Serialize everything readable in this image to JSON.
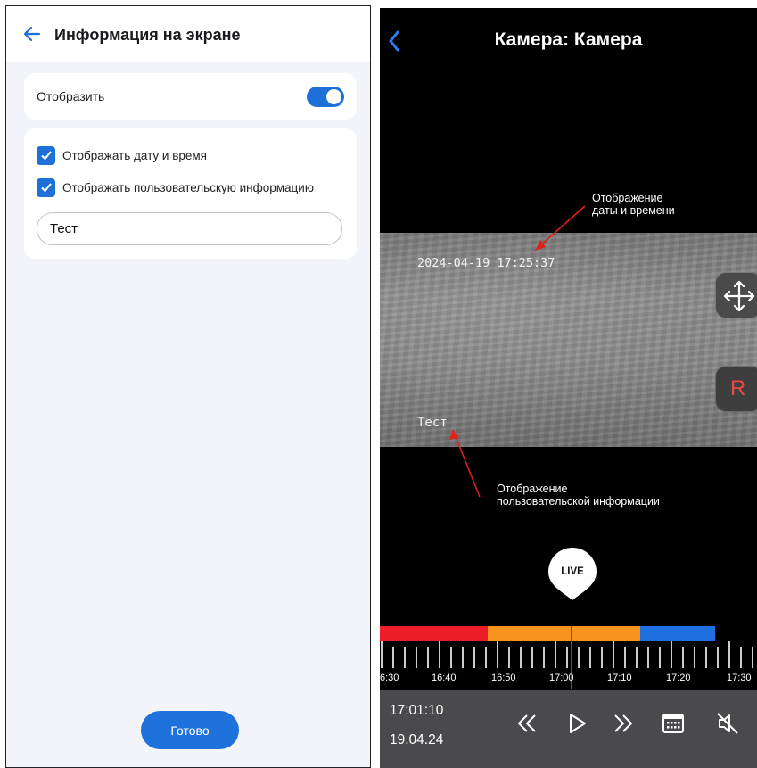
{
  "settings": {
    "title": "Информация на экране",
    "display_label": "Отобразить",
    "display_toggle_on": true,
    "option_datetime": "Отображать дату и время",
    "option_user_info": "Отображать пользовательскую информацию",
    "user_text_value": "Тест",
    "done_label": "Готово",
    "accent_color": "#1f6fd8"
  },
  "camera": {
    "title": "Камера: Камера",
    "osd_datetime": "2024-04-19 17:25:37",
    "osd_user_text": "Тест",
    "rec_label": "R",
    "annotation_datetime": [
      "Отображение",
      "даты и времени"
    ],
    "annotation_user": [
      "Отображение",
      "пользовательской информации"
    ],
    "live_label": "LIVE",
    "timeline_labels": [
      "6:30",
      "16:40",
      "16:50",
      "17:00",
      "17:10",
      "17:20",
      "17:30"
    ],
    "current_time": "17:01:10",
    "current_date": "19.04.24",
    "icons": [
      "back-icon",
      "move-arrows-icon",
      "rewind-icon",
      "play-icon",
      "fast-forward-icon",
      "calendar-icon",
      "mute-icon"
    ]
  }
}
